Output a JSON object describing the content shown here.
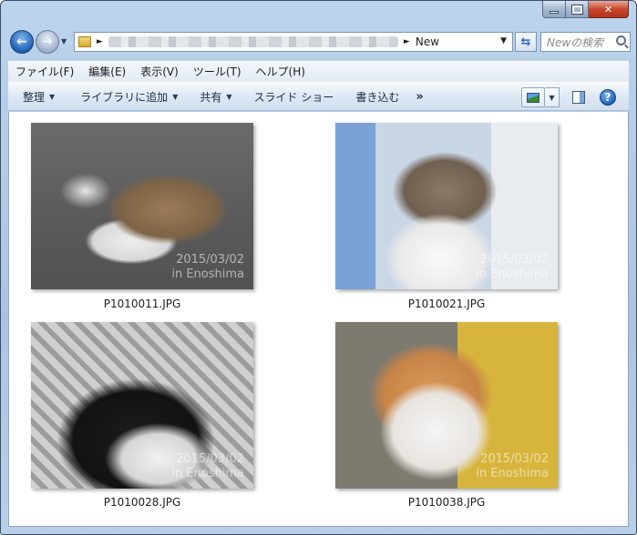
{
  "window": {
    "caption_buttons": [
      "minimize",
      "maximize",
      "close"
    ]
  },
  "address": {
    "current_folder": "New",
    "search_placeholder": "Newの検索"
  },
  "menubar": {
    "items": [
      "ファイル(F)",
      "編集(E)",
      "表示(V)",
      "ツール(T)",
      "ヘルプ(H)"
    ]
  },
  "commandbar": {
    "organize": "整理",
    "add_to_library": "ライブラリに追加",
    "share": "共有",
    "slideshow": "スライド ショー",
    "burn": "書き込む",
    "more": "»"
  },
  "files": [
    {
      "name": "P1010011.JPG",
      "stamp_date": "2015/03/02",
      "stamp_place": "in Enoshima"
    },
    {
      "name": "P1010021.JPG",
      "stamp_date": "2015/03/02",
      "stamp_place": "in Enoshima"
    },
    {
      "name": "P1010028.JPG",
      "stamp_date": "2015/03/02",
      "stamp_place": "in Enoshima"
    },
    {
      "name": "P1010038.JPG",
      "stamp_date": "2015/03/02",
      "stamp_place": "in Enoshima"
    }
  ]
}
